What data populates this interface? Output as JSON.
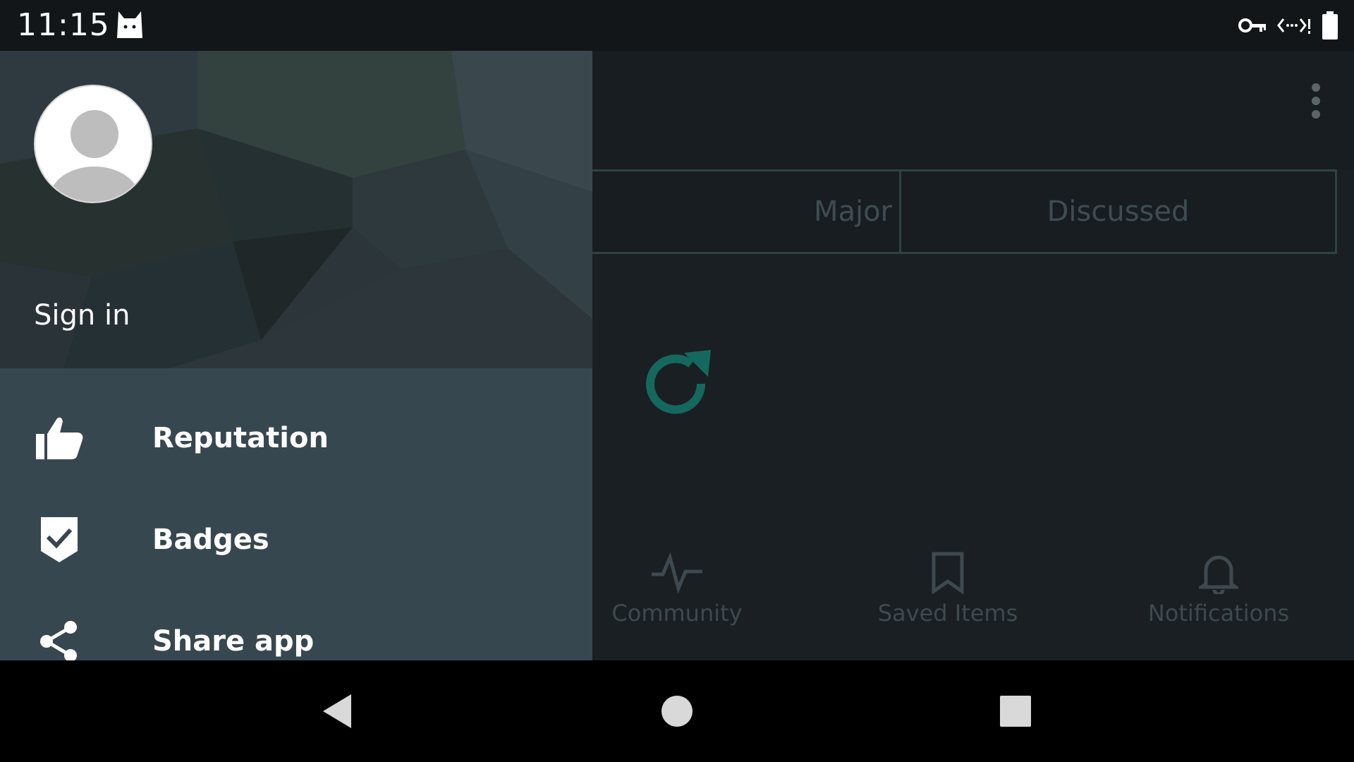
{
  "status_bar": {
    "time": "11:15",
    "icons": [
      "cat-icon",
      "vpn-key-icon",
      "data-transfer-icon",
      "battery-icon"
    ]
  },
  "app": {
    "tabs": [
      {
        "label": "Major"
      },
      {
        "label": "Discussed"
      }
    ],
    "bottom_nav": [
      {
        "label": "Community",
        "icon": "activity-icon"
      },
      {
        "label": "Saved Items",
        "icon": "bookmark-icon"
      },
      {
        "label": "Notifications",
        "icon": "bell-icon"
      }
    ],
    "accent_color": "#15685e"
  },
  "drawer": {
    "sign_in": "Sign in",
    "items": [
      {
        "label": "Reputation",
        "icon": "thumbs-up-icon"
      },
      {
        "label": "Badges",
        "icon": "badge-check-icon"
      },
      {
        "label": "Share app",
        "icon": "share-icon"
      }
    ]
  },
  "system_nav": {
    "buttons": [
      "back-icon",
      "home-icon",
      "recent-apps-icon"
    ]
  }
}
